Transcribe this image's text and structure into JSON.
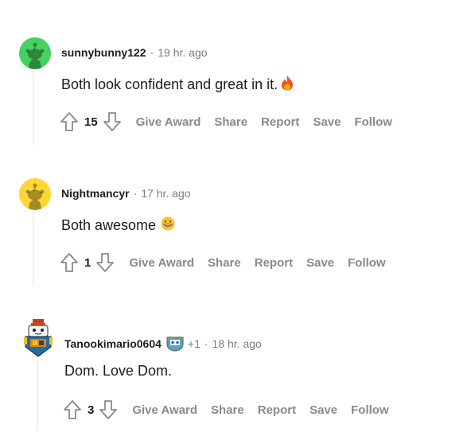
{
  "comments": [
    {
      "username": "sunnybunny122",
      "time": "19 hr. ago",
      "text": "Both look confident and great in it.",
      "emoji": "fire-emoji",
      "score": "15",
      "avatar_color": "#46d160",
      "actions": {
        "give_award": "Give Award",
        "share": "Share",
        "report": "Report",
        "save": "Save",
        "follow": "Follow"
      }
    },
    {
      "username": "Nightmancyr",
      "time": "17 hr. ago",
      "text": "Both awesome",
      "emoji": "grinning-emoji",
      "score": "1",
      "avatar_color": "#ffd635",
      "actions": {
        "give_award": "Give Award",
        "share": "Share",
        "report": "Report",
        "save": "Save",
        "follow": "Follow"
      }
    },
    {
      "username": "Tanookimario0604",
      "time": "18 hr. ago",
      "flair_count": "+1",
      "text": "Dom. Love Dom.",
      "score": "3",
      "actions": {
        "give_award": "Give Award",
        "share": "Share",
        "report": "Report",
        "save": "Save",
        "follow": "Follow"
      }
    }
  ],
  "separator": "·"
}
